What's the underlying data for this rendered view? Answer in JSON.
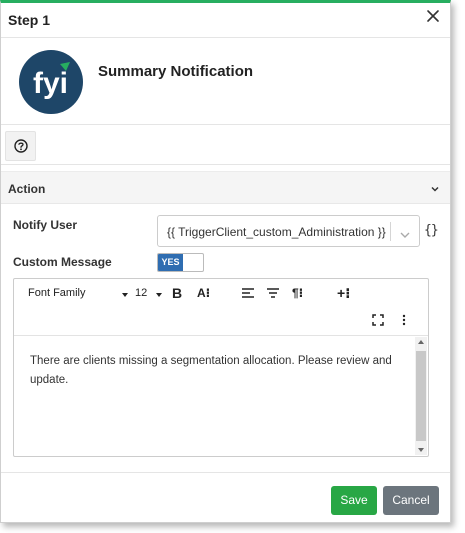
{
  "dialog": {
    "title": "Step 1",
    "close_icon": "close-icon"
  },
  "header": {
    "logo_text": "fyi",
    "logo_color": "#1e4668",
    "logo_accent": "#27ae60",
    "title": "Summary Notification"
  },
  "help": {
    "icon": "help-circle-icon"
  },
  "action": {
    "label": "Action",
    "chevron_icon": "chevron-down-icon"
  },
  "form": {
    "notify_user": {
      "label": "Notify User",
      "value": "{{ TriggerClient_custom_Administration }}",
      "braces_icon": "{}"
    },
    "custom_message": {
      "label": "Custom Message",
      "toggle_value": "YES"
    }
  },
  "editor": {
    "toolbar": {
      "font_family": "Font Family",
      "font_size": "12",
      "bold": "B",
      "text_style": "A⁝",
      "align_left_icon": "align-left-icon",
      "align_center_icon": "align-center-icon",
      "paragraph": "¶⁝",
      "insert": "+⁝",
      "fullscreen_icon": "fullscreen-icon",
      "more_icon": "more-vertical-icon"
    },
    "content": "There are clients missing a segmentation allocation. Please review and update."
  },
  "buttons": {
    "save": "Save",
    "cancel": "Cancel"
  },
  "colors": {
    "accent": "#27ae60",
    "save": "#28a745",
    "cancel": "#6c757d",
    "toggle": "#2f6db1"
  }
}
